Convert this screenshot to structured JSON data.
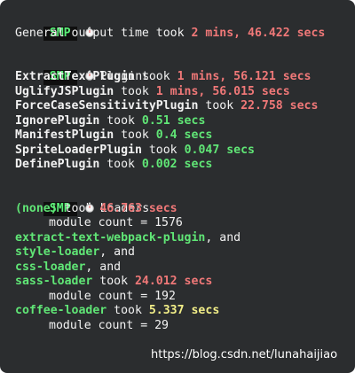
{
  "badge": "SMP",
  "general": {
    "label": "General output time took ",
    "time": "2 mins, 46.422 secs"
  },
  "plugins": {
    "header": "Plugins",
    "items": [
      {
        "name": "ExtractTextPlugin",
        "took": " took ",
        "time": "1 mins, 56.121 secs",
        "severity": "red"
      },
      {
        "name": "UglifyJSPlugin",
        "took": " took ",
        "time": "1 mins, 56.015 secs",
        "severity": "red"
      },
      {
        "name": "ForceCaseSensitivityPlugin",
        "took": " took ",
        "time": "22.758 secs",
        "severity": "red"
      },
      {
        "name": "IgnorePlugin",
        "took": " took ",
        "time": "0.51 secs",
        "severity": "green"
      },
      {
        "name": "ManifestPlugin",
        "took": " took ",
        "time": "0.4 secs",
        "severity": "green"
      },
      {
        "name": "SpriteLoaderPlugin",
        "took": " took ",
        "time": "0.047 secs",
        "severity": "green"
      },
      {
        "name": "DefinePlugin",
        "took": " took ",
        "time": "0.002 secs",
        "severity": "green"
      }
    ]
  },
  "loaders": {
    "header": "Loaders",
    "none": {
      "name": "(none)",
      "took": " took ",
      "time": "46.763 secs",
      "module_count": "module count = 1576"
    },
    "group1": {
      "line1": {
        "name": "extract-text-webpack-plugin",
        "suffix": ", and"
      },
      "line2": {
        "name": "style-loader",
        "suffix": ", and"
      },
      "line3": {
        "name": "css-loader",
        "suffix": ", and"
      },
      "line4": {
        "name": "sass-loader",
        "took": " took ",
        "time": "24.012 secs"
      },
      "module_count": "module count = 192"
    },
    "coffee": {
      "name": "coffee-loader",
      "took": " took ",
      "time": "5.337 secs",
      "module_count": "module count = 29"
    }
  },
  "watermark": "https://blog.csdn.net/lunahaijiao",
  "colors": {
    "background": "#2b2d2f",
    "badge_bg": "#0f0f0f",
    "badge_fg": "#5af078",
    "slow": "#f07878",
    "fast": "#60e676",
    "medium": "#f2ee88"
  },
  "icons": [
    "stopwatch-icon"
  ]
}
